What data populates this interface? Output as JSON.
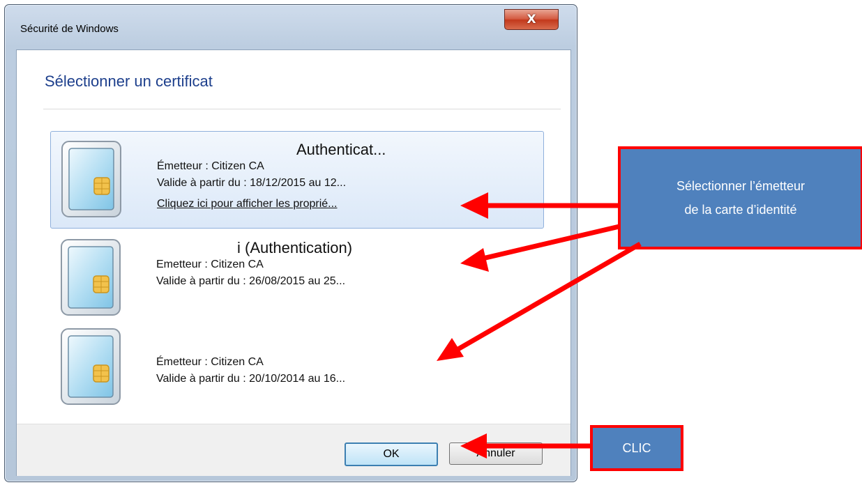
{
  "window": {
    "title": "Sécurité de Windows",
    "close_glyph": "X",
    "heading": "Sélectionner un certificat"
  },
  "certificates": [
    {
      "title": "Authenticat...",
      "issuer": "Émetteur : Citizen CA",
      "validity": "Valide à partir du : 18/12/2015 au 12...",
      "link": "Cliquez ici pour afficher les proprié...",
      "selected": true,
      "icon": "smart-card-icon"
    },
    {
      "title": "i (Authentication)",
      "issuer": "Emetteur : Citizen CA",
      "validity": "Valide à partir du : 26/08/2015 au 25...",
      "selected": false,
      "icon": "smart-card-icon"
    },
    {
      "title": "",
      "issuer": "Émetteur : Citizen CA",
      "validity": "Valide à partir du : 20/10/2014 au 16...",
      "selected": false,
      "icon": "smart-card-icon"
    }
  ],
  "buttons": {
    "ok": "OK",
    "cancel": "Annuler"
  },
  "annotations": {
    "main_callout_line1": "Sélectionner l’émetteur",
    "main_callout_line2": "de la carte d’identité",
    "clic_callout": "CLIC",
    "callout_fill": "#4f81bd",
    "callout_border": "#ff0000",
    "arrow_color": "#ff0000"
  }
}
